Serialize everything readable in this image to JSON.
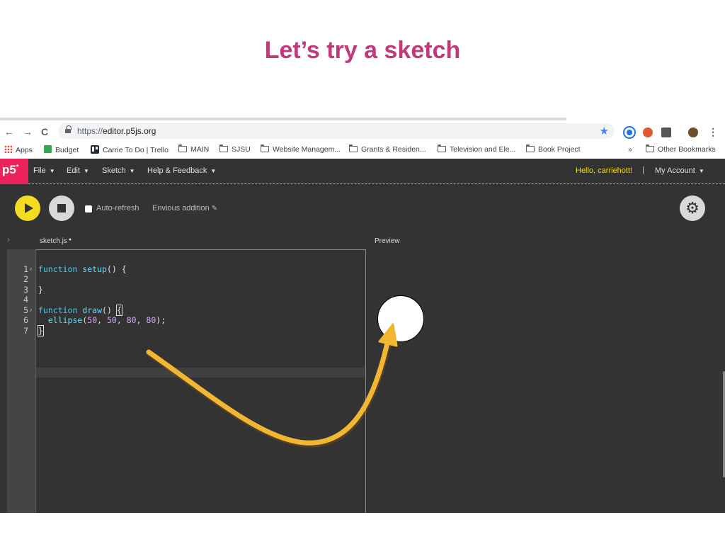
{
  "slide": {
    "title": "Let’s try a sketch"
  },
  "browser": {
    "url_scheme": "https://",
    "url_host": "editor.p5js.org",
    "bookmarks": [
      "Apps",
      "Budget",
      "Carrie To Do | Trello",
      "MAIN",
      "SJSU",
      "Website Managem...",
      "Grants & Residen...",
      "Television and Ele...",
      "Book Project",
      "Other Bookmarks"
    ],
    "overflow": "»"
  },
  "editor": {
    "logo": "p5",
    "logo_mark": "*",
    "menu": [
      "File",
      "Edit",
      "Sketch",
      "Help & Feedback"
    ],
    "hello": "Hello, carriehott!",
    "separator": "|",
    "account": "My Account",
    "autorefresh_label": "Auto-refresh",
    "sketch_name": "Envious addition",
    "tab_name": "sketch.js",
    "tab_modified": "●",
    "preview_label": "Preview",
    "line_numbers": [
      "1",
      "2",
      "3",
      "4",
      "5",
      "6",
      "7"
    ],
    "code": {
      "l1_kw": "function",
      "l1_fn": "setup",
      "l1_rest": "() {",
      "l3": "}",
      "l5_kw": "function",
      "l5_fn": "draw",
      "l5_rest": "() ",
      "l5_brace": "{",
      "l6_fn": "ellipse",
      "l6_a": "(",
      "l6_n1": "50",
      "l6_c1": ", ",
      "l6_n2": "50",
      "l6_c2": ", ",
      "l6_n3": "80",
      "l6_c3": ", ",
      "l6_n4": "80",
      "l6_end": ");",
      "l7": "}"
    }
  },
  "colors": {
    "title": "#c0397a",
    "editor_bg": "#333333",
    "p5_pink": "#ed225d",
    "play_yellow": "#f5dc23",
    "arrow": "#f2b632"
  },
  "icons": [
    "back-icon",
    "forward-icon",
    "reload-icon",
    "lock-icon",
    "star-icon",
    "play-icon",
    "stop-icon",
    "gear-icon",
    "pencil-icon",
    "folder-icon"
  ]
}
